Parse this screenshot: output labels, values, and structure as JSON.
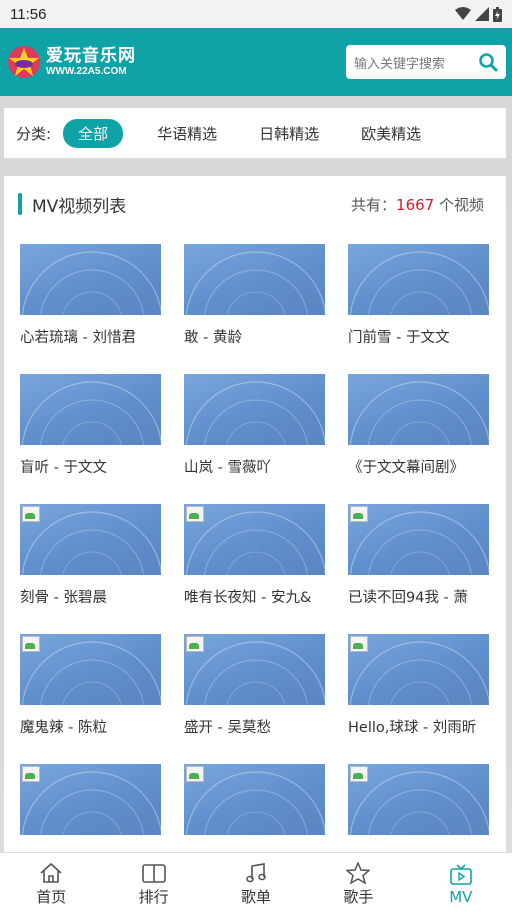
{
  "status_bar": {
    "time": "11:56"
  },
  "header": {
    "logo_title": "爱玩音乐网",
    "logo_url": "WWW.22A5.COM",
    "search_placeholder": "输入关键字搜索"
  },
  "category": {
    "label": "分类:",
    "tabs": [
      {
        "label": "全部",
        "active": true
      },
      {
        "label": "华语精选",
        "active": false
      },
      {
        "label": "日韩精选",
        "active": false
      },
      {
        "label": "欧美精选",
        "active": false
      }
    ]
  },
  "list": {
    "title": "MV视频列表",
    "count_prefix": "共有：",
    "count": "1667",
    "count_suffix": " 个视频",
    "items": [
      {
        "title": "心若琉璃 - 刘惜君",
        "thumb_loaded": true
      },
      {
        "title": "敢 - 黄龄",
        "thumb_loaded": true
      },
      {
        "title": "门前雪 - 于文文",
        "thumb_loaded": true
      },
      {
        "title": "盲听 - 于文文",
        "thumb_loaded": true
      },
      {
        "title": "山岚 - 雪薇吖",
        "thumb_loaded": true
      },
      {
        "title": "《于文文幕间剧》",
        "thumb_loaded": true
      },
      {
        "title": "刻骨 - 张碧晨",
        "thumb_loaded": false
      },
      {
        "title": "唯有长夜知 - 安九&",
        "thumb_loaded": false
      },
      {
        "title": "已读不回94我 - 萧",
        "thumb_loaded": false
      },
      {
        "title": "魔鬼辣 - 陈粒",
        "thumb_loaded": false
      },
      {
        "title": "盛开 - 吴莫愁",
        "thumb_loaded": false
      },
      {
        "title": "Hello,球球 - 刘雨昕",
        "thumb_loaded": false
      },
      {
        "title": "",
        "thumb_loaded": false
      },
      {
        "title": "",
        "thumb_loaded": false
      },
      {
        "title": "",
        "thumb_loaded": false
      }
    ]
  },
  "bottom_nav": [
    {
      "label": "首页",
      "icon": "home-icon",
      "active": false
    },
    {
      "label": "排行",
      "icon": "book-icon",
      "active": false
    },
    {
      "label": "歌单",
      "icon": "music-note-icon",
      "active": false
    },
    {
      "label": "歌手",
      "icon": "star-icon",
      "active": false
    },
    {
      "label": "MV",
      "icon": "tv-icon",
      "active": true
    }
  ],
  "colors": {
    "accent": "#0fa3a7",
    "count": "#d0202a"
  }
}
